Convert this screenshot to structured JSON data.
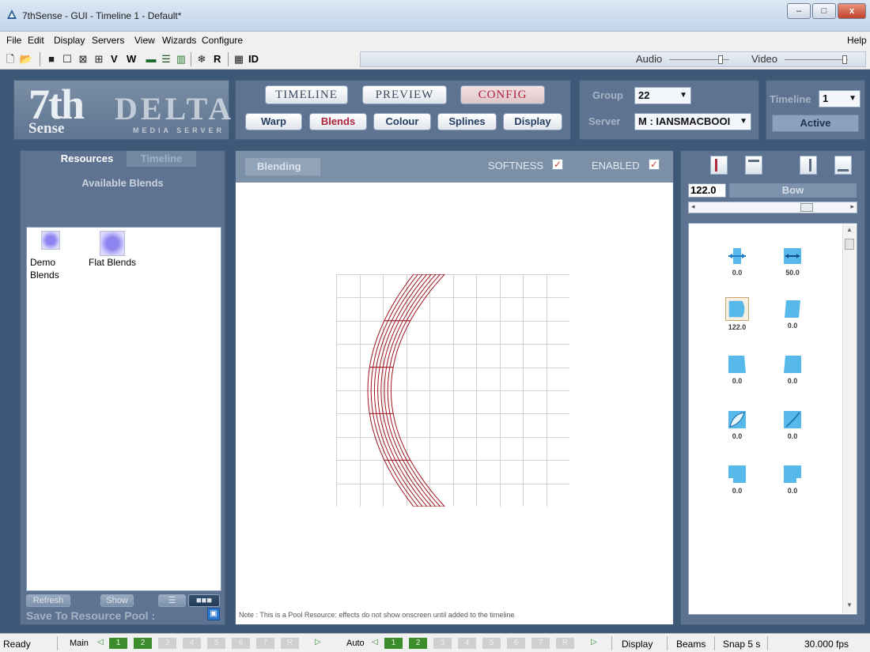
{
  "window": {
    "title": "7thSense -  GUI - Timeline 1 - Default*",
    "min": "–",
    "max": "□",
    "close": "x"
  },
  "menu": {
    "file": "File",
    "edit": "Edit",
    "display": "Display",
    "servers": "Servers",
    "view": "View",
    "wizards": "Wizards",
    "configure": "Configure",
    "help": "Help"
  },
  "toolbar": {
    "v": "V",
    "w": "W",
    "r": "R",
    "id": "ID",
    "audio": "Audio",
    "video": "Video",
    "audio_level": 0.88,
    "video_level": 0.98
  },
  "logo": {
    "seven": "7th",
    "sense": "Sense",
    "delta": "DELTA",
    "media_server": "MEDIA SERVER"
  },
  "nav": {
    "timeline": "TIMELINE",
    "preview": "PREVIEW",
    "config": "CONFIG",
    "warp": "Warp",
    "blends": "Blends",
    "colour": "Colour",
    "splines": "Splines",
    "display": "Display"
  },
  "group": {
    "label": "Group",
    "value": "22",
    "server_label": "Server",
    "server_value": "M : IANSMACBOOI"
  },
  "timeline_sel": {
    "label": "Timeline",
    "value": "1",
    "status": "Active"
  },
  "resources": {
    "tab_resources": "Resources",
    "tab_timeline": "Timeline",
    "heading": "Available Blends",
    "items": [
      {
        "label": "Demo Blends"
      },
      {
        "label": "Flat Blends"
      }
    ],
    "refresh": "Refresh",
    "show": "Show",
    "save_pool": "Save To Resource Pool :"
  },
  "blending": {
    "title": "Blending",
    "softness": "SOFTNESS",
    "enabled": "ENABLED",
    "check": "✓",
    "note": "Note : This is a Pool Resource: effects do not show onscreen until added to the timeline"
  },
  "edge": {
    "value": "122.0",
    "mode": "Bow",
    "slider_level": 0.72,
    "values": [
      "0.0",
      "50.0",
      "122.0",
      "0.0",
      "0.0",
      "0.0",
      "0.0",
      "0.0",
      "0.0",
      "0.0"
    ]
  },
  "status": {
    "ready": "Ready",
    "main": "Main",
    "auto": "Auto",
    "display": "Display",
    "beams": "Beams",
    "snap": "Snap 5 s",
    "fps": "30.000 fps",
    "pages": [
      "1",
      "2",
      "3",
      "4",
      "5",
      "6",
      "7",
      "R"
    ]
  },
  "colors": {
    "frame": "#3e5878",
    "panel": "#5d7391",
    "accent_red": "#b2233a",
    "warp_line": "#a0141e",
    "page_on": "#3c8c2c"
  }
}
